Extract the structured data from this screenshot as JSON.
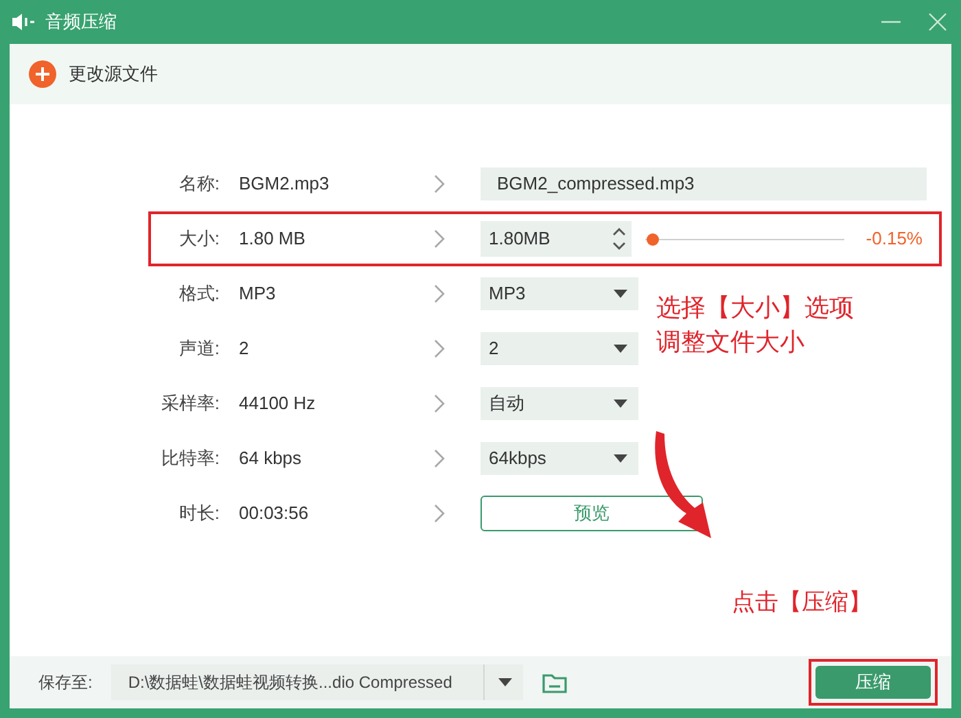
{
  "window": {
    "title": "音频压缩"
  },
  "change_source": {
    "label": "更改源文件"
  },
  "rows": [
    {
      "kind": "name",
      "label": "名称:",
      "value": "BGM2.mp3",
      "output": "BGM2_compressed.mp3",
      "highlighted": false
    },
    {
      "kind": "size",
      "label": "大小:",
      "value": "1.80 MB",
      "output": "1.80MB",
      "level": 0.02,
      "reading": "-0.15%",
      "highlighted": true
    },
    {
      "kind": "select",
      "label": "格式:",
      "value": "MP3",
      "output": "MP3",
      "highlighted": false
    },
    {
      "kind": "select",
      "label": "声道:",
      "value": "2",
      "output": "2",
      "highlighted": false
    },
    {
      "kind": "select",
      "label": "采样率:",
      "value": "44100 Hz",
      "output": "自动",
      "highlighted": false
    },
    {
      "kind": "select",
      "label": "比特率:",
      "value": "64 kbps",
      "output": "64kbps",
      "highlighted": false
    },
    {
      "kind": "preview",
      "label": "时长:",
      "value": "00:03:56",
      "output": "预览",
      "highlighted": false
    }
  ],
  "annotations": {
    "size_note": [
      "选择【大小】选项",
      "调整文件大小"
    ],
    "compress_note": "点击【压缩】"
  },
  "footer": {
    "save_label": "保存至:",
    "save_path": "D:\\数据蛙\\数据蛙视频转换...dio Compressed",
    "compress_button": "压缩",
    "compress_highlighted": true
  }
}
